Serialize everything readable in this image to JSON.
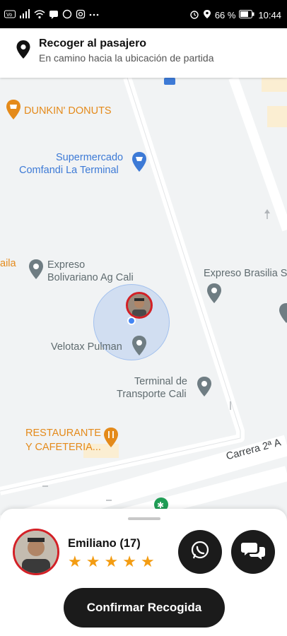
{
  "status_bar": {
    "left_icons": [
      "volte-icon",
      "signal-icon",
      "wifi-icon",
      "message-icon",
      "whatsapp-icon",
      "instagram-icon",
      "more-icon"
    ],
    "battery_percent": "66 %",
    "time": "10:44"
  },
  "header": {
    "title": "Recoger al pasajero",
    "subtitle": "En camino hacia la ubicación de partida"
  },
  "map": {
    "places": {
      "dunkin": "DUNKIN' DONUTS",
      "supermercado_1": "Supermercado",
      "supermercado_2": "Comfandi La Terminal",
      "expreso_bol_1": "Expreso",
      "expreso_bol_2": "Bolivariano Ag Cali",
      "expreso_brasilia": "Expreso Brasilia S",
      "velotax": "Velotax Pulman",
      "terminal_1": "Terminal de",
      "terminal_2": "Transporte Cali",
      "restaurante_1": "RESTAURANTE",
      "restaurante_2": "Y CAFETERIA...",
      "partial_left": "aila",
      "street": "Carrera 2ª A"
    }
  },
  "driver": {
    "name": "Emiliano (17)",
    "rating": 5
  },
  "actions": {
    "whatsapp_icon": "whatsapp-icon",
    "chat_icon": "chat-icon",
    "confirm_label": "Confirmar Recogida"
  },
  "colors": {
    "accent_dark": "#1b1b1b",
    "star": "#f39c12",
    "avatar_ring": "#d32026",
    "poi_gray": "#6f7d83",
    "poi_blue": "#3d7ad6",
    "poi_orange": "#e48a1a"
  }
}
